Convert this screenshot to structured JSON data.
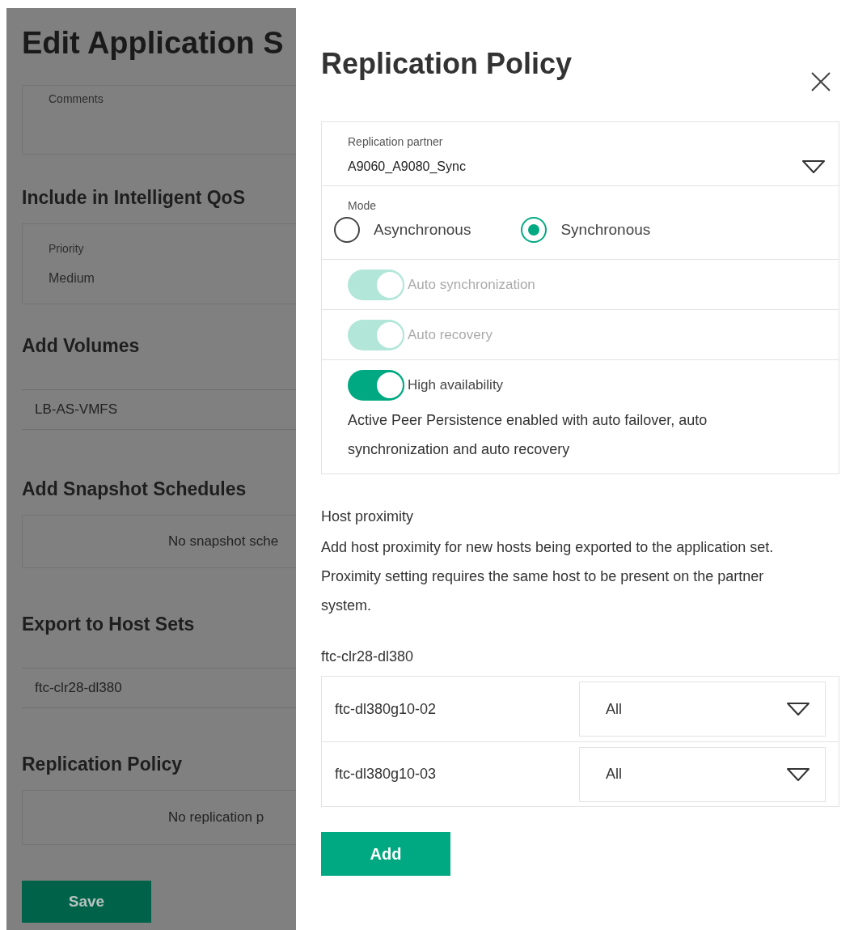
{
  "left_page": {
    "title": "Edit Application S",
    "sections": [
      {
        "kind": "textarea",
        "label": "Comments"
      },
      {
        "kind": "select",
        "heading": "Include in Intelligent QoS",
        "label": "Priority",
        "value": "Medium"
      },
      {
        "kind": "list",
        "heading": "Add Volumes",
        "items": [
          "LB-AS-VMFS"
        ]
      },
      {
        "kind": "empty",
        "heading": "Add Snapshot Schedules",
        "message": "No snapshot sche"
      },
      {
        "kind": "list",
        "heading": "Export to Host Sets",
        "items": [
          "ftc-clr28-dl380"
        ]
      },
      {
        "kind": "empty",
        "heading": "Replication Policy",
        "message": "No replication p"
      }
    ],
    "save_button": "Save"
  },
  "drawer": {
    "title": "Replication Policy",
    "replication_partner": {
      "label": "Replication partner",
      "value": "A9060_A9080_Sync"
    },
    "mode": {
      "label": "Mode",
      "options": [
        {
          "label": "Asynchronous",
          "selected": false
        },
        {
          "label": "Synchronous",
          "selected": true
        }
      ]
    },
    "toggles": [
      {
        "label": "Auto synchronization",
        "on": true,
        "disabled": true
      },
      {
        "label": "Auto recovery",
        "on": true,
        "disabled": true
      },
      {
        "label": "High availability",
        "on": true,
        "disabled": false,
        "description": "Active Peer Persistence enabled with auto failover, auto synchronization and auto recovery"
      }
    ],
    "host_proximity": {
      "label": "Host proximity",
      "description": "Add host proximity for new hosts being exported to the application set. Proximity setting requires the same host to be present on the partner system.",
      "host_set": "ftc-clr28-dl380",
      "rows": [
        {
          "host": "ftc-dl380g10-02",
          "proximity": "All"
        },
        {
          "host": "ftc-dl380g10-03",
          "proximity": "All"
        }
      ]
    },
    "add_button": "Add"
  }
}
